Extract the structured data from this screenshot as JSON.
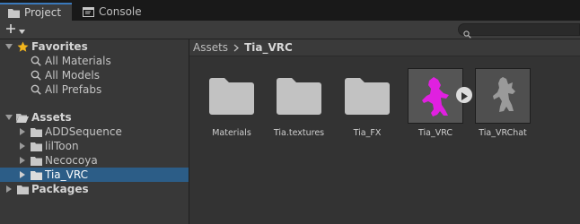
{
  "tabs": [
    {
      "label": "Project",
      "icon": "folder-icon",
      "active": true
    },
    {
      "label": "Console",
      "icon": "console-icon",
      "active": false
    }
  ],
  "toolbar": {
    "create_label": "+",
    "create_icon": "plus-icon",
    "dropdown_icon": "caret-down-icon",
    "search_icon": "search-icon"
  },
  "tree": {
    "favorites": {
      "label": "Favorites",
      "icon": "star-icon",
      "items": [
        {
          "label": "All Materials",
          "icon": "search-icon"
        },
        {
          "label": "All Models",
          "icon": "search-icon"
        },
        {
          "label": "All Prefabs",
          "icon": "search-icon"
        }
      ]
    },
    "assets": {
      "label": "Assets",
      "icon": "folder-icon",
      "items": [
        {
          "label": "ADDSequence",
          "icon": "folder-icon"
        },
        {
          "label": "lilToon",
          "icon": "folder-icon"
        },
        {
          "label": "Necocoya",
          "icon": "folder-icon"
        },
        {
          "label": "Tia_VRC",
          "icon": "folder-icon",
          "selected": true
        }
      ]
    },
    "packages": {
      "label": "Packages",
      "icon": "folder-icon"
    }
  },
  "breadcrumb": {
    "root": "Assets",
    "current": "Tia_VRC"
  },
  "assets_grid": [
    {
      "label": "Materials",
      "type": "folder"
    },
    {
      "label": "Tia.textures",
      "type": "folder"
    },
    {
      "label": "Tia_FX",
      "type": "folder"
    },
    {
      "label": "Tia_VRC",
      "type": "prefab-model",
      "accent": "#e020e0"
    },
    {
      "label": "Tia_VRChat",
      "type": "prefab-variant",
      "accent": "#9a9a9a"
    }
  ],
  "colors": {
    "selection": "#2c5d87",
    "active_tab_border": "#3a79bb",
    "star": "#f2b51d"
  }
}
